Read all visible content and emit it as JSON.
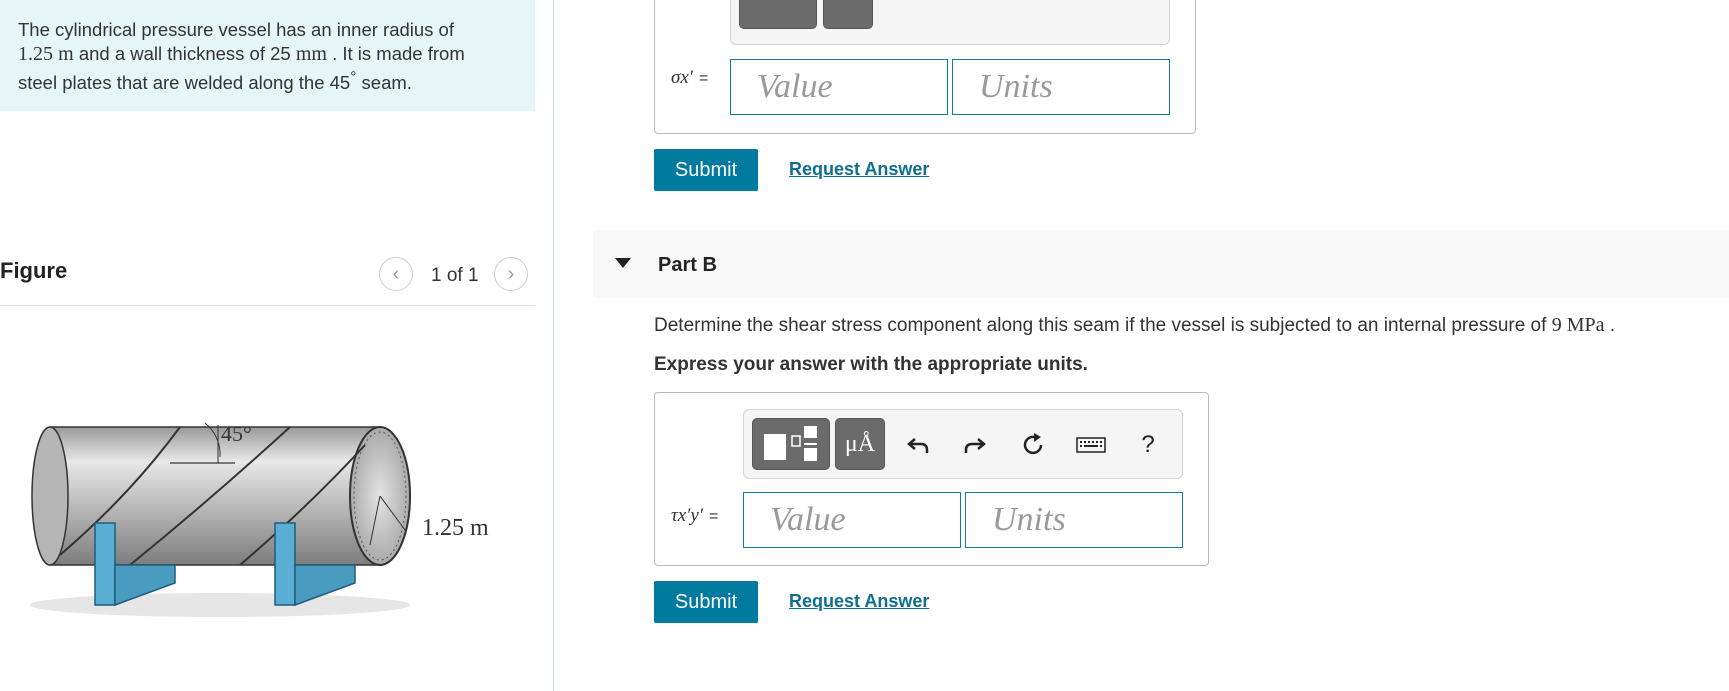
{
  "problem": {
    "line1": "The cylindrical pressure vessel has an inner radius of",
    "radius_value": "1.25",
    "radius_unit": "m",
    "line2_mid": " and a wall thickness of 25 ",
    "thickness_unit": "mm",
    "line2_end": " . It is made from",
    "line3_start": "steel plates that are welded along the 45",
    "degree": "°",
    "line3_end": " seam."
  },
  "figure": {
    "title": "Figure",
    "counter": "1 of 1",
    "angle_label": "45°",
    "radius_label": "1.25 m"
  },
  "partA": {
    "var_label": "σx′",
    "equals": "=",
    "value_placeholder": "Value",
    "units_placeholder": "Units",
    "submit_label": "Submit",
    "request_label": "Request Answer"
  },
  "partB": {
    "title": "Part B",
    "question_start": "Determine the shear stress component along this seam if the vessel is subjected to an internal pressure of ",
    "pressure": "9 MPa",
    "question_end": " .",
    "instruction": "Express your answer with the appropriate units.",
    "var_label": "τx′y′",
    "equals": "=",
    "value_placeholder": "Value",
    "units_placeholder": "Units",
    "units_button": "μÅ",
    "help_label": "?",
    "submit_label": "Submit",
    "request_label": "Request Answer"
  },
  "colors": {
    "accent": "#007a9e",
    "problem_bg": "#e6f5f6",
    "input_border": "#0e7c9a"
  }
}
